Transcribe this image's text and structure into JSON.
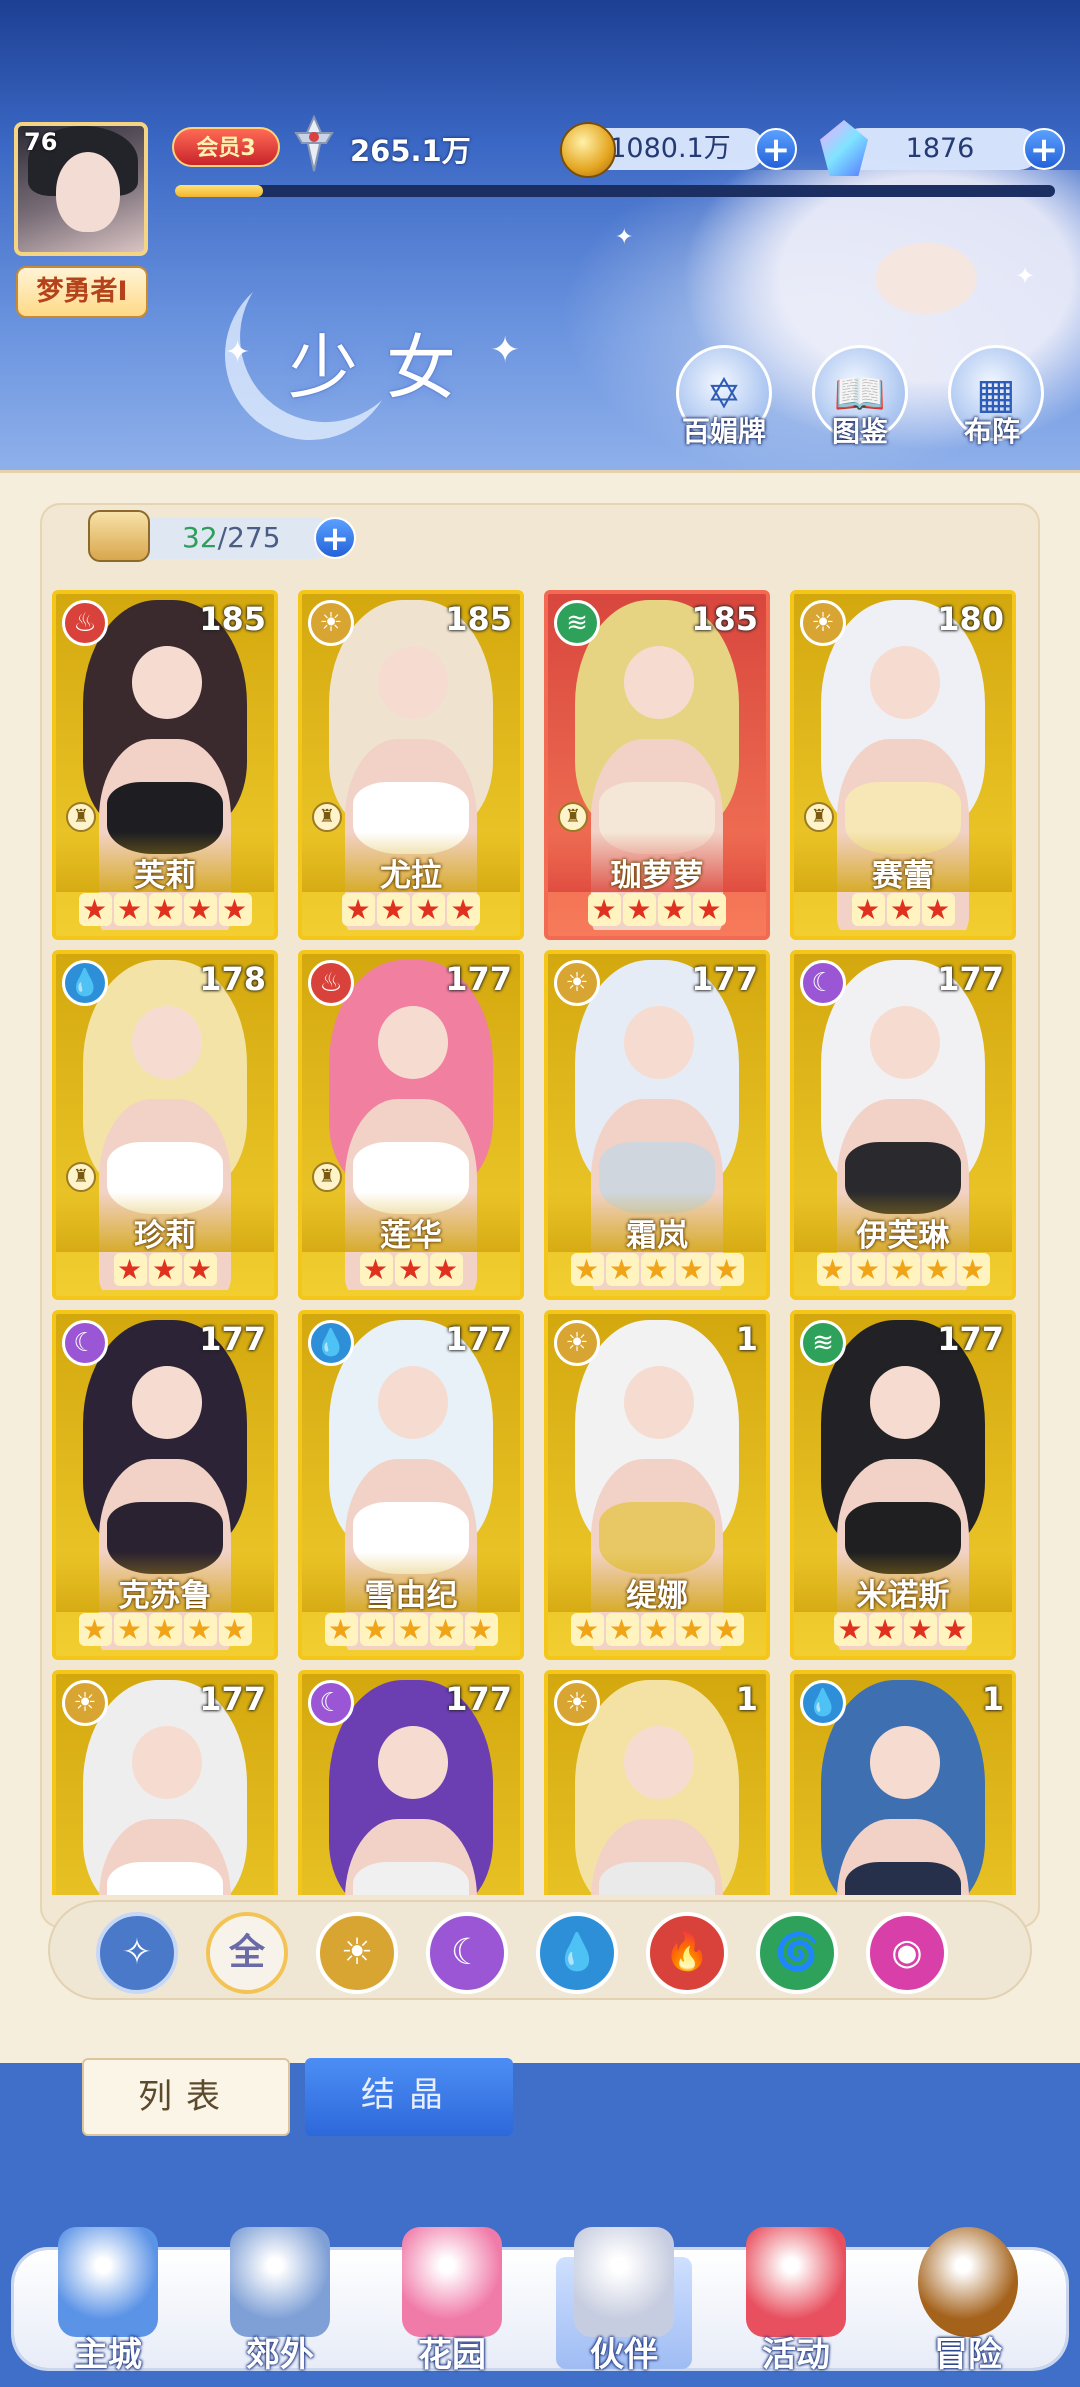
{
  "player": {
    "level": "76",
    "name": "梦勇者I",
    "vip_label": "会员3",
    "power": "265.1万",
    "exp_fraction": 0.1
  },
  "resources": {
    "coins": "1080.1万",
    "gems": "1876"
  },
  "page": {
    "title": "少女"
  },
  "header_buttons": [
    "百媚牌",
    "图鉴",
    "布阵"
  ],
  "capacity": {
    "current": "32",
    "total": "/275"
  },
  "cards": [
    {
      "name": "芙莉",
      "level": "185",
      "element": "fire",
      "stars": 5,
      "star_color": "red",
      "theme": "gold",
      "pawn": true
    },
    {
      "name": "尤拉",
      "level": "185",
      "element": "light",
      "stars": 4,
      "star_color": "red",
      "theme": "gold",
      "pawn": true
    },
    {
      "name": "珈萝萝",
      "level": "185",
      "element": "wind",
      "stars": 4,
      "star_color": "red",
      "theme": "red",
      "pawn": true
    },
    {
      "name": "赛蕾",
      "level": "180",
      "element": "light",
      "stars": 3,
      "star_color": "red",
      "theme": "gold",
      "pawn": true
    },
    {
      "name": "珍莉",
      "level": "178",
      "element": "water",
      "stars": 3,
      "star_color": "red",
      "theme": "gold",
      "pawn": true
    },
    {
      "name": "莲华",
      "level": "177",
      "element": "fire",
      "stars": 3,
      "star_color": "red",
      "theme": "gold",
      "pawn": true
    },
    {
      "name": "霜岚",
      "level": "177",
      "element": "light",
      "stars": 5,
      "star_color": "gold",
      "theme": "gold",
      "pawn": false
    },
    {
      "name": "伊芙琳",
      "level": "177",
      "element": "dark",
      "stars": 5,
      "star_color": "gold",
      "theme": "gold",
      "pawn": false
    },
    {
      "name": "克苏鲁",
      "level": "177",
      "element": "dark",
      "stars": 5,
      "star_color": "gold",
      "theme": "gold",
      "pawn": false
    },
    {
      "name": "雪由纪",
      "level": "177",
      "element": "water",
      "stars": 5,
      "star_color": "gold",
      "theme": "gold",
      "pawn": false
    },
    {
      "name": "缇娜",
      "level": "1",
      "element": "light",
      "stars": 5,
      "star_color": "gold",
      "theme": "gold",
      "pawn": false
    },
    {
      "name": "米诺斯",
      "level": "177",
      "element": "wind",
      "stars": 4,
      "star_color": "red",
      "theme": "gold",
      "pawn": false
    },
    {
      "name": "",
      "level": "177",
      "element": "light",
      "stars": 0,
      "star_color": "gold",
      "theme": "gold",
      "pawn": false
    },
    {
      "name": "",
      "level": "177",
      "element": "dark",
      "stars": 0,
      "star_color": "gold",
      "theme": "gold",
      "pawn": false
    },
    {
      "name": "",
      "level": "1",
      "element": "light",
      "stars": 0,
      "star_color": "gold",
      "theme": "gold",
      "pawn": false
    },
    {
      "name": "",
      "level": "1",
      "element": "water",
      "stars": 0,
      "star_color": "gold",
      "theme": "gold",
      "pawn": false
    }
  ],
  "filters": [
    {
      "icon": "ascend-icon",
      "label": "",
      "color": "#4a79c9"
    },
    {
      "icon": "all-icon",
      "label": "全",
      "color": "#f7f3ea"
    },
    {
      "icon": "light-element-icon",
      "label": "☀",
      "color": "#d9a532"
    },
    {
      "icon": "dark-element-icon",
      "label": "☾",
      "color": "#9a56d4"
    },
    {
      "icon": "water-element-icon",
      "label": "💧",
      "color": "#2e8fd9"
    },
    {
      "icon": "fire-element-icon",
      "label": "🔥",
      "color": "#d9423a"
    },
    {
      "icon": "wind-element-icon",
      "label": "🌀",
      "color": "#2ea25a"
    },
    {
      "icon": "chaos-element-icon",
      "label": "◉",
      "color": "#d83fa8"
    }
  ],
  "tabs": [
    "列表",
    "结晶"
  ],
  "nav": [
    {
      "label": "主城",
      "icon": "castle-icon",
      "color": "#5b93e6"
    },
    {
      "label": "郊外",
      "icon": "portal-icon",
      "color": "#7fa0d6"
    },
    {
      "label": "花园",
      "icon": "heart-icon",
      "color": "#f07aa8"
    },
    {
      "label": "伙伴",
      "icon": "partner-icon",
      "color": "#c7cde0"
    },
    {
      "label": "活动",
      "icon": "gift-icon",
      "color": "#e8505f"
    },
    {
      "label": "冒险",
      "icon": "compass-icon",
      "color": "#a4621b"
    }
  ]
}
